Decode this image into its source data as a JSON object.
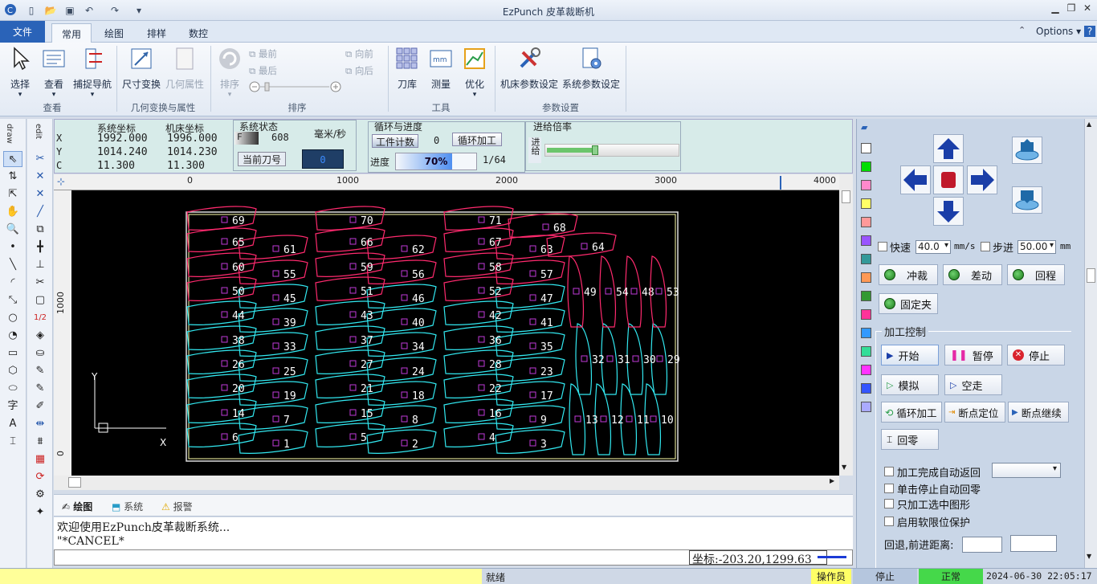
{
  "app": {
    "title": "EzPunch 皮革裁断机",
    "options_label": "Options"
  },
  "tabs": {
    "file": "文件",
    "items": [
      "常用",
      "绘图",
      "排样",
      "数控"
    ]
  },
  "ribbon": {
    "select": "选择",
    "view": "查看",
    "snap": "捕捉导航",
    "size_transform": "尺寸变换",
    "geom_props": "几何属性",
    "sort": "排序",
    "front_most": "最前",
    "back_most": "最后",
    "forward": "向前",
    "backward": "向后",
    "tool_lib": "刀库",
    "measure": "测量",
    "optimize": "优化",
    "machine_params": "机床参数设定",
    "system_params": "系统参数设定",
    "group_view": "查看",
    "group_geo": "几何变换与属性",
    "group_sort": "排序",
    "group_tools": "工具",
    "group_params": "参数设置"
  },
  "status": {
    "sys_coord_label": "系统坐标",
    "machine_coord_label": "机床坐标",
    "x_label": "X",
    "y_label": "Y",
    "c_label": "C",
    "sys_x": "1992.000",
    "sys_y": "1014.240",
    "sys_c": "11.300",
    "mach_x": "1996.000",
    "mach_y": "1014.230",
    "mach_c": "11.300",
    "sys_state_label": "系统状态",
    "feed_label": "F",
    "feed_value": "608",
    "speed_unit": "毫米/秒",
    "current_tool_label": "当前刀号",
    "current_tool_value": "0",
    "cycle_label": "循环与进度",
    "work_count_label": "工件计数",
    "work_count_value": "0",
    "cycle_process_label": "循环加工",
    "progress_label": "进度",
    "progress_value": "70%",
    "progress_pct": 70,
    "progress_ratio": "1/64",
    "feed_rate_label": "进给倍率",
    "feed_rate_side": "进给"
  },
  "ruler": {
    "x_ticks": [
      "0",
      "1000",
      "2000",
      "3000",
      "4000"
    ],
    "y_ticks": [
      "1000",
      "0"
    ]
  },
  "canvas": {
    "axis_y": "Y",
    "axis_x": "X",
    "pieces": [
      "1",
      "2",
      "3",
      "4",
      "5",
      "6",
      "7",
      "8",
      "9",
      "10",
      "11",
      "12",
      "13",
      "14",
      "15",
      "16",
      "17",
      "18",
      "19",
      "20",
      "21",
      "22",
      "23",
      "24",
      "25",
      "26",
      "27",
      "28",
      "29",
      "30",
      "31",
      "32",
      "33",
      "34",
      "35",
      "36",
      "37",
      "38",
      "39",
      "40",
      "41",
      "42",
      "43",
      "44",
      "45",
      "46",
      "47",
      "48",
      "49",
      "50",
      "51",
      "52",
      "53",
      "54",
      "55",
      "56",
      "57",
      "58",
      "59",
      "60",
      "61",
      "62",
      "63",
      "64",
      "65",
      "66",
      "67",
      "68",
      "69",
      "70",
      "71"
    ]
  },
  "bottom_tabs": {
    "draw": "绘图",
    "system": "系统",
    "alarm": "报警"
  },
  "console": {
    "line1": "欢迎使用EzPunch皮革裁断系统...",
    "line2": "\"*CANCEL*",
    "coords": "坐标:-203.20,1299.63"
  },
  "right": {
    "fast_label": "快速",
    "fast_value": "40.0",
    "unit_speed": "mm/s",
    "step_label": "步进",
    "step_value": "50.00",
    "unit_mm": "mm",
    "punch": "冲裁",
    "diff": "差动",
    "return": "回程",
    "fixed_clamp": "固定夹",
    "process_control": "加工控制",
    "start": "开始",
    "pause": "暂停",
    "stop": "停止",
    "simulate": "模拟",
    "dry_run": "空走",
    "cycle_process": "循环加工",
    "breakpoint_locate": "断点定位",
    "breakpoint_continue": "断点继续",
    "home": "回零",
    "auto_return": "加工完成自动返回",
    "single_stop_home": "单击停止自动回零",
    "process_selected": "只加工选中图形",
    "soft_limit": "启用软限位保护",
    "back_forward_dist": "回退,前进距离:"
  },
  "statusbar": {
    "ready": "就绪",
    "operator": "操作员",
    "stopped": "停止",
    "normal": "正常",
    "datetime": "2024-06-30  22:05:17"
  },
  "colors": {
    "palette": [
      "#ffffff",
      "#00dd00",
      "#ff88cc",
      "#ffff66",
      "#ff9999",
      "#9955ff",
      "#339999",
      "#ff9955",
      "#339933",
      "#ff3399",
      "#3399ff",
      "#33dd99",
      "#ff33ff",
      "#3355ff",
      "#aaaaff"
    ]
  }
}
